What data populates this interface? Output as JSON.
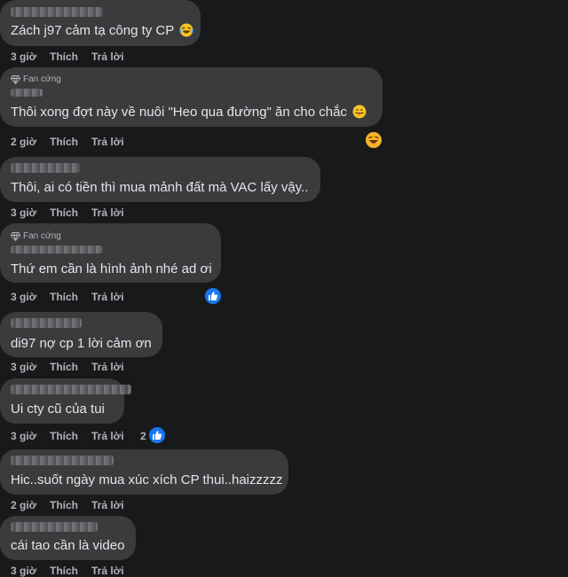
{
  "comments": [
    {
      "text": "Zách j97 cảm tạ công ty CP",
      "time": "3 giờ",
      "like": "Thích",
      "reply": "Trả lời",
      "emoji": "laughing-tears-icon"
    },
    {
      "badge": "Fan cứng",
      "text": "Thôi xong đợt này về nuôi \"Heo qua đường\" ăn cho chắc",
      "time": "2 giờ",
      "like": "Thích",
      "reply": "Trả lời",
      "emoji": "tongue-out-icon",
      "reaction": "haha-icon"
    },
    {
      "text": "Thôi, ai có tiền thì mua mảnh đất mà VAC lấy vậy..",
      "time": "3 giờ",
      "like": "Thích",
      "reply": "Trả lời"
    },
    {
      "badge": "Fan cứng",
      "text": "Thứ em cần là hình ảnh nhé ad ơi",
      "time": "3 giờ",
      "like": "Thích",
      "reply": "Trả lời",
      "reaction": "like-icon"
    },
    {
      "text": "di97 nợ cp 1 lời cảm ơn",
      "time": "3 giờ",
      "like": "Thích",
      "reply": "Trả lời"
    },
    {
      "text": "Ui cty cũ của tui",
      "time": "3 giờ",
      "like": "Thích",
      "reply": "Trả lời",
      "reaction": "like-icon",
      "reaction_count": "2"
    },
    {
      "text": "Hic..suốt ngày mua xúc xích CP thui..haizzzzz",
      "time": "2 giờ",
      "like": "Thích",
      "reply": "Trả lời"
    },
    {
      "text": "cái tao cần là video",
      "time": "3 giờ",
      "like": "Thích",
      "reply": "Trả lời"
    }
  ],
  "colors": {
    "background": "#18191a",
    "bubble": "#3a3b3c",
    "text": "#e4e6eb",
    "secondary_text": "#b0b3b8",
    "like_blue": "#1877f2",
    "haha_yellow": "#f7b125"
  }
}
